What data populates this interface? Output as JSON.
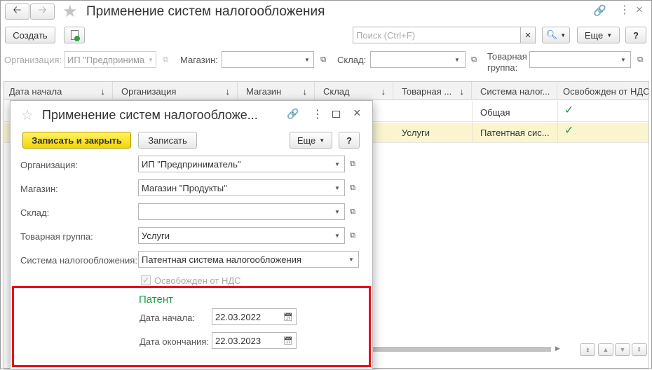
{
  "main": {
    "title": "Применение систем налогообложения",
    "create_label": "Создать",
    "search_placeholder": "Поиск (Ctrl+F)",
    "search_clear": "×",
    "more_label": "Еще",
    "help_label": "?",
    "filters": {
      "org_label": "Организация:",
      "org_value": "ИП \"Предпринима",
      "shop_label": "Магазин:",
      "warehouse_label": "Склад:",
      "group_label": "Товарная\nгруппа:"
    },
    "columns": [
      "Дата начала",
      "Организация",
      "Магазин",
      "Склад",
      "Товарная ...",
      "Система налог...",
      "Освобожден от НДС"
    ],
    "sort_arrow": "↓",
    "rows": [
      {
        "group": "",
        "system": "Общая",
        "vat": "✓"
      },
      {
        "group": "Услуги",
        "system": "Патентная сис...",
        "vat": "✓"
      }
    ]
  },
  "dialog": {
    "title": "Применение систем налогообложе...",
    "save_close_label": "Записать и закрыть",
    "save_label": "Записать",
    "more_label": "Еще",
    "help_label": "?",
    "fields": {
      "org_label": "Организация:",
      "org_value": "ИП \"Предприниматель\"",
      "shop_label": "Магазин:",
      "shop_value": "Магазин \"Продукты\"",
      "warehouse_label": "Склад:",
      "warehouse_value": "",
      "group_label": "Товарная группа:",
      "group_value": "Услуги",
      "system_label": "Система налогообложения:",
      "system_value": "Патентная система налогообложения",
      "vat_label": "Освобожден от НДС"
    },
    "patent": {
      "header": "Патент",
      "start_label": "Дата начала:",
      "start_value": "22.03.2022",
      "end_label": "Дата окончания:",
      "end_value": "22.03.2023"
    }
  },
  "colors": {
    "accent_yellow": "#f2d600",
    "highlight_row": "#fbf5cf",
    "patent_green": "#1a9b3c",
    "annotation_red": "#e8101a"
  }
}
